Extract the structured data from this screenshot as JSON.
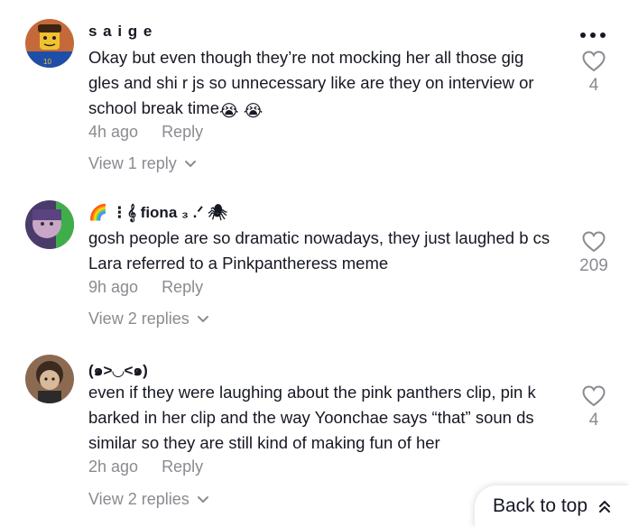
{
  "comments": [
    {
      "username": "s a i g e",
      "text": "Okay but even though they’re not mocking her all those gig gles and shi r js so unnecessary like are they on interview or school break time",
      "time": "4h ago",
      "reply_label": "Reply",
      "view_replies": "View 1 reply",
      "likes": "4",
      "emoji": [
        "😭",
        "😭"
      ]
    },
    {
      "username": "🌈 ⋮𝄞 fiona ₃ .ᐟ 🕷",
      "text": "gosh people are so dramatic nowadays, they just laughed b cs Lara referred to a Pinkpantheress meme",
      "time": "9h ago",
      "reply_label": "Reply",
      "view_replies": "View 2 replies",
      "likes": "209"
    },
    {
      "username": "(๑>◡<๑)",
      "text": "even if they were laughing about the pink panthers clip, pin k barked in her clip and the way Yoonchae says “that” soun ds similar so they are still kind of making fun of her",
      "time": "2h ago",
      "reply_label": "Reply",
      "view_replies": "View 2 replies",
      "likes": "4"
    }
  ],
  "back_to_top": "Back to top",
  "icons": {
    "more": "more-options-icon",
    "like": "heart-outline-icon",
    "chevron": "chevron-down-icon",
    "back_to_top": "double-chevron-up-icon"
  },
  "colors": {
    "text": "#161823",
    "muted": "#8a8b91"
  }
}
